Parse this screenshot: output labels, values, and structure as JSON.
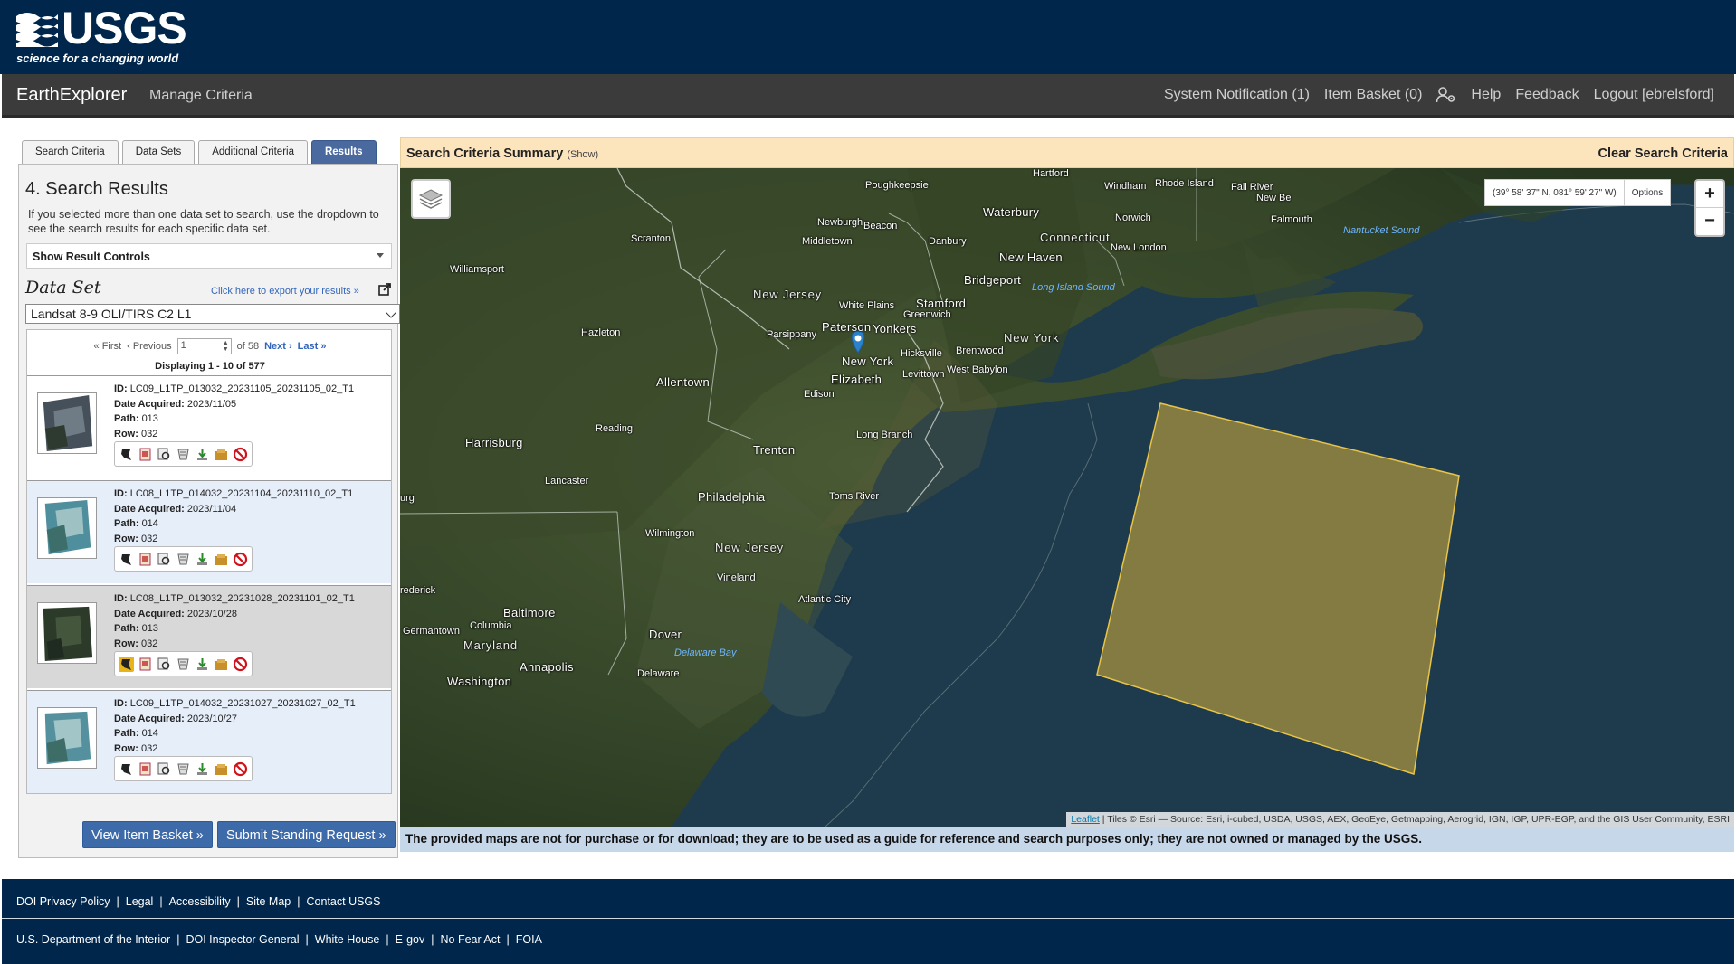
{
  "header": {
    "logo_text": "USGS",
    "tagline": "science for a changing world"
  },
  "nav": {
    "brand": "EarthExplorer",
    "manage_criteria": "Manage Criteria",
    "system_notification": "System Notification (1)",
    "item_basket": "Item Basket (0)",
    "help": "Help",
    "feedback": "Feedback",
    "logout": "Logout [ebrelsford]"
  },
  "tabs": [
    {
      "label": "Search Criteria"
    },
    {
      "label": "Data Sets"
    },
    {
      "label": "Additional Criteria"
    },
    {
      "label": "Results",
      "active": true
    }
  ],
  "results": {
    "title": "4. Search Results",
    "help_text": "If you selected more than one data set to search, use the dropdown to see the search results for each specific data set.",
    "show_controls": "Show Result Controls",
    "dataset_label": "Data Set",
    "export_link": "Click here to export your results »",
    "dataset_selected": "Landsat 8-9 OLI/TIRS C2 L1",
    "pager": {
      "first": "« First",
      "previous": "‹ Previous",
      "page": "1",
      "of": "of 58",
      "next": "Next ›",
      "last": "Last »"
    },
    "displaying": "Displaying 1 - 10 of 577",
    "labels": {
      "id": "ID:",
      "date": "Date Acquired:",
      "path": "Path:",
      "row": "Row:"
    },
    "items": [
      {
        "id": "LC09_L1TP_013032_20231105_20231105_02_T1",
        "date": "2023/11/05",
        "path": "013",
        "row": "032"
      },
      {
        "id": "LC08_L1TP_014032_20231104_20231110_02_T1",
        "date": "2023/11/04",
        "path": "014",
        "row": "032"
      },
      {
        "id": "LC08_L1TP_013032_20231028_20231101_02_T1",
        "date": "2023/10/28",
        "path": "013",
        "row": "032"
      },
      {
        "id": "LC09_L1TP_014032_20231027_20231027_02_T1",
        "date": "2023/10/27",
        "path": "014",
        "row": "032"
      }
    ],
    "view_basket": "View Item Basket »",
    "standing_request": "Submit Standing Request »"
  },
  "criteria_bar": {
    "title": "Search Criteria Summary",
    "show": "(Show)",
    "clear": "Clear Search Criteria"
  },
  "map": {
    "coords": "(39° 58' 37\" N, 081° 59' 27\" W)",
    "options": "Options",
    "zoom_in": "+",
    "zoom_out": "−",
    "attribution_link": "Leaflet",
    "attribution_text": " | Tiles © Esri — Source: Esri, i-cubed, USDA, USGS, AEX, GeoEye, Getmapping, Aerogrid, IGN, IGP, UPR-EGP, and the GIS User Community, ESRI",
    "places": [
      {
        "name": "Hartford"
      },
      {
        "name": "Poughkeepsie"
      },
      {
        "name": "Windham"
      },
      {
        "name": "Rhode Island"
      },
      {
        "name": "Fall River"
      },
      {
        "name": "New Be"
      },
      {
        "name": "Falmouth"
      },
      {
        "name": "Waterbury"
      },
      {
        "name": "Norwich"
      },
      {
        "name": "Newburgh"
      },
      {
        "name": "Beacon"
      },
      {
        "name": "Middletown"
      },
      {
        "name": "Danbury"
      },
      {
        "name": "Connecticut"
      },
      {
        "name": "New London"
      },
      {
        "name": "New Haven"
      },
      {
        "name": "Scranton"
      },
      {
        "name": "Williamsport"
      },
      {
        "name": "Bridgeport"
      },
      {
        "name": "Long Island Sound"
      },
      {
        "name": "Nantucket Sound"
      },
      {
        "name": "New Jersey"
      },
      {
        "name": "White Plains"
      },
      {
        "name": "Stamford"
      },
      {
        "name": "Greenwich"
      },
      {
        "name": "Paterson"
      },
      {
        "name": "Yonkers"
      },
      {
        "name": "Parsippany"
      },
      {
        "name": "Hazleton"
      },
      {
        "name": "New York"
      },
      {
        "name": "New York"
      },
      {
        "name": "Hicksville"
      },
      {
        "name": "Brentwood"
      },
      {
        "name": "Elizabeth"
      },
      {
        "name": "Levittown"
      },
      {
        "name": "West Babylon"
      },
      {
        "name": "Allentown"
      },
      {
        "name": "Edison"
      },
      {
        "name": "Reading"
      },
      {
        "name": "Long Branch"
      },
      {
        "name": "Harrisburg"
      },
      {
        "name": "Trenton"
      },
      {
        "name": "Lancaster"
      },
      {
        "name": "Philadelphia"
      },
      {
        "name": "Toms River"
      },
      {
        "name": "urg"
      },
      {
        "name": "Wilmington"
      },
      {
        "name": "New Jersey"
      },
      {
        "name": "Vineland"
      },
      {
        "name": "rederick"
      },
      {
        "name": "Atlantic City"
      },
      {
        "name": "Baltimore"
      },
      {
        "name": "Columbia"
      },
      {
        "name": "Germantown"
      },
      {
        "name": "Dover"
      },
      {
        "name": "Maryland"
      },
      {
        "name": "Delaware Bay"
      },
      {
        "name": "Annapolis"
      },
      {
        "name": "Delaware"
      },
      {
        "name": "Washington"
      }
    ]
  },
  "disclaimer": "The provided maps are not for purchase or for download; they are to be used as a guide for reference and search purposes only; they are not owned or managed by the USGS.",
  "footer": {
    "row1": [
      "DOI Privacy Policy",
      "Legal",
      "Accessibility",
      "Site Map",
      "Contact USGS"
    ],
    "row2": [
      "U.S. Department of the Interior",
      "DOI Inspector General",
      "White House",
      "E-gov",
      "No Fear Act",
      "FOIA"
    ]
  },
  "colors": {
    "header_bg": "#00264c",
    "nav_bg": "#3b3b3b",
    "accent": "#3d6aa8",
    "footprint": "#d8b13a"
  }
}
